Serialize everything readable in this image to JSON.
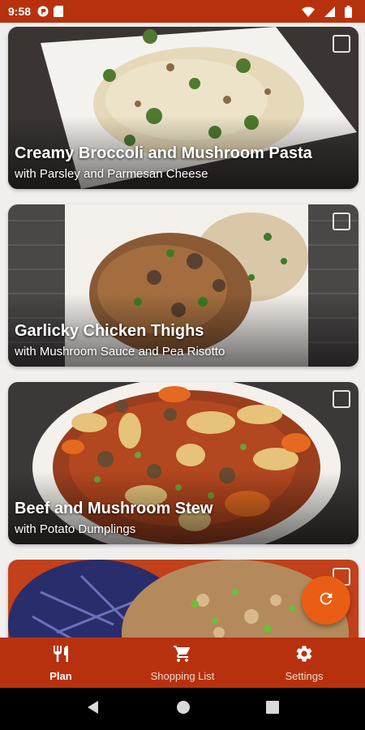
{
  "status_bar": {
    "time": "9:58",
    "left_icons": [
      "notification-app-icon",
      "sd-card-icon"
    ],
    "right_icons": [
      "wifi-icon",
      "signal-icon",
      "battery-icon"
    ]
  },
  "colors": {
    "brand": "#b8310e",
    "fab": "#e95e14",
    "background": "#f1efee"
  },
  "recipes": [
    {
      "title": "Creamy Broccoli and Mushroom Pasta",
      "subtitle": "with Parsley and Parmesan Cheese",
      "checked": false
    },
    {
      "title": "Garlicky Chicken Thighs",
      "subtitle": "with Mushroom Sauce and Pea Risotto",
      "checked": false
    },
    {
      "title": "Beef and Mushroom Stew",
      "subtitle": "with Potato Dumplings",
      "checked": false
    },
    {
      "title": "",
      "subtitle": "",
      "checked": false
    }
  ],
  "fab": {
    "icon": "refresh-icon"
  },
  "bottom_nav": {
    "items": [
      {
        "label": "Plan",
        "icon": "fork-knife-icon",
        "active": true
      },
      {
        "label": "Shopping List",
        "icon": "cart-icon",
        "active": false
      },
      {
        "label": "Settings",
        "icon": "gear-icon",
        "active": false
      }
    ]
  },
  "system_nav": [
    "back-icon",
    "home-icon",
    "recents-icon"
  ]
}
